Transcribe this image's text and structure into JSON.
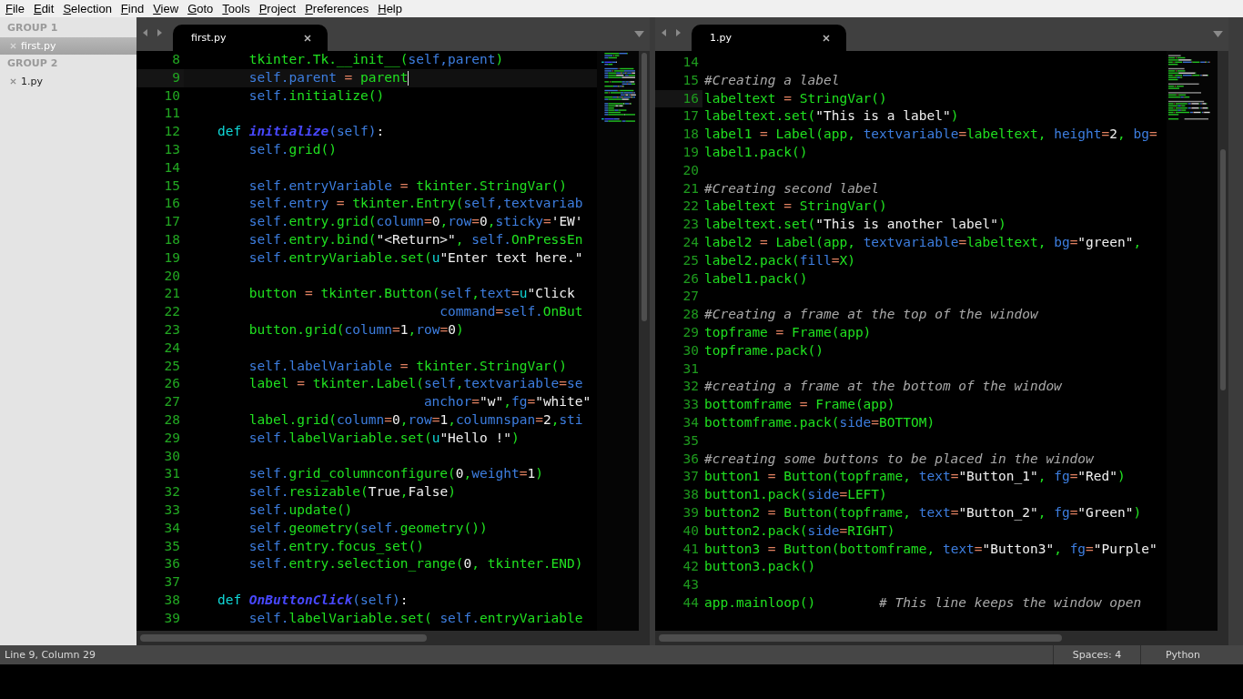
{
  "menu": [
    "File",
    "Edit",
    "Selection",
    "Find",
    "View",
    "Goto",
    "Tools",
    "Project",
    "Preferences",
    "Help"
  ],
  "sidebar": {
    "groups": [
      {
        "title": "GROUP 1",
        "files": [
          {
            "name": "first.py",
            "selected": true
          }
        ]
      },
      {
        "title": "GROUP 2",
        "files": [
          {
            "name": "1.py",
            "selected": false
          }
        ]
      }
    ]
  },
  "panes": [
    {
      "tabs": [
        {
          "label": "first.py",
          "selected": true
        }
      ],
      "focused": true,
      "lines": [
        {
          "num": "8",
          "current": false,
          "tokens": [
            {
              "kind": "name",
              "text": "        tkinter.Tk.__init__("
            },
            {
              "kind": "self",
              "text": "self,parent"
            },
            {
              "kind": "name",
              "text": ")"
            }
          ]
        },
        {
          "num": "9",
          "current": true,
          "tokens": [
            {
              "kind": "self",
              "text": "        self.parent"
            },
            {
              "kind": "op",
              "text": " = "
            },
            {
              "kind": "name",
              "text": "parent"
            }
          ]
        },
        {
          "num": "10",
          "current": false,
          "tokens": [
            {
              "kind": "self",
              "text": "        self."
            },
            {
              "kind": "name",
              "text": "initialize()"
            }
          ]
        },
        {
          "num": "11",
          "current": false
        },
        {
          "num": "12",
          "current": false,
          "tokens": [
            {
              "kind": "keyword",
              "text": "    def "
            },
            {
              "kind": "defname",
              "text": "initialize"
            },
            {
              "kind": "self",
              "text": "(self)"
            },
            {
              "kind": "literal",
              "text": ":"
            }
          ]
        },
        {
          "num": "13",
          "current": false,
          "tokens": [
            {
              "kind": "self",
              "text": "        self."
            },
            {
              "kind": "name",
              "text": "grid()"
            }
          ]
        },
        {
          "num": "14",
          "current": false
        },
        {
          "num": "15",
          "current": false,
          "tokens": [
            {
              "kind": "self",
              "text": "        self.entryVariable"
            },
            {
              "kind": "op",
              "text": " = "
            },
            {
              "kind": "name",
              "text": "tkinter.StringVar()"
            }
          ]
        },
        {
          "num": "16",
          "current": false,
          "tokens": [
            {
              "kind": "self",
              "text": "        self.entry"
            },
            {
              "kind": "op",
              "text": " = "
            },
            {
              "kind": "name",
              "text": "tkinter.Entry("
            },
            {
              "kind": "self",
              "text": "self,textvariab"
            }
          ]
        },
        {
          "num": "17",
          "current": false,
          "tokens": [
            {
              "kind": "self",
              "text": "        self."
            },
            {
              "kind": "name",
              "text": "entry.grid("
            },
            {
              "kind": "arg",
              "text": "column"
            },
            {
              "kind": "op",
              "text": "="
            },
            {
              "kind": "literal",
              "text": "0"
            },
            {
              "kind": "name",
              "text": ","
            },
            {
              "kind": "arg",
              "text": "row"
            },
            {
              "kind": "op",
              "text": "="
            },
            {
              "kind": "literal",
              "text": "0"
            },
            {
              "kind": "name",
              "text": ","
            },
            {
              "kind": "arg",
              "text": "sticky"
            },
            {
              "kind": "op",
              "text": "="
            },
            {
              "kind": "literal",
              "text": "'EW'"
            }
          ]
        },
        {
          "num": "18",
          "current": false,
          "tokens": [
            {
              "kind": "self",
              "text": "        self."
            },
            {
              "kind": "name",
              "text": "entry.bind("
            },
            {
              "kind": "literal",
              "text": "\"<Return>\""
            },
            {
              "kind": "name",
              "text": ", "
            },
            {
              "kind": "self",
              "text": "self."
            },
            {
              "kind": "name",
              "text": "OnPressEn"
            }
          ]
        },
        {
          "num": "19",
          "current": false,
          "tokens": [
            {
              "kind": "self",
              "text": "        self."
            },
            {
              "kind": "name",
              "text": "entryVariable.set("
            },
            {
              "kind": "keyword",
              "text": "u"
            },
            {
              "kind": "literal",
              "text": "\"Enter text here.\""
            }
          ]
        },
        {
          "num": "20",
          "current": false
        },
        {
          "num": "21",
          "current": false,
          "tokens": [
            {
              "kind": "name",
              "text": "        button"
            },
            {
              "kind": "op",
              "text": " = "
            },
            {
              "kind": "name",
              "text": "tkinter.Button("
            },
            {
              "kind": "self",
              "text": "self"
            },
            {
              "kind": "name",
              "text": ","
            },
            {
              "kind": "arg",
              "text": "text"
            },
            {
              "kind": "op",
              "text": "="
            },
            {
              "kind": "keyword",
              "text": "u"
            },
            {
              "kind": "literal",
              "text": "\"Click"
            }
          ]
        },
        {
          "num": "22",
          "current": false,
          "tokens": [
            {
              "kind": "arg",
              "text": "                                command"
            },
            {
              "kind": "op",
              "text": "="
            },
            {
              "kind": "self",
              "text": "self."
            },
            {
              "kind": "name",
              "text": "OnBut"
            }
          ]
        },
        {
          "num": "23",
          "current": false,
          "tokens": [
            {
              "kind": "name",
              "text": "        button.grid("
            },
            {
              "kind": "arg",
              "text": "column"
            },
            {
              "kind": "op",
              "text": "="
            },
            {
              "kind": "literal",
              "text": "1"
            },
            {
              "kind": "name",
              "text": ","
            },
            {
              "kind": "arg",
              "text": "row"
            },
            {
              "kind": "op",
              "text": "="
            },
            {
              "kind": "literal",
              "text": "0"
            },
            {
              "kind": "name",
              "text": ")"
            }
          ]
        },
        {
          "num": "24",
          "current": false
        },
        {
          "num": "25",
          "current": false,
          "tokens": [
            {
              "kind": "self",
              "text": "        self.labelVariable"
            },
            {
              "kind": "op",
              "text": " = "
            },
            {
              "kind": "name",
              "text": "tkinter.StringVar()"
            }
          ]
        },
        {
          "num": "26",
          "current": false,
          "tokens": [
            {
              "kind": "name",
              "text": "        label"
            },
            {
              "kind": "op",
              "text": " = "
            },
            {
              "kind": "name",
              "text": "tkinter.Label("
            },
            {
              "kind": "self",
              "text": "self"
            },
            {
              "kind": "name",
              "text": ","
            },
            {
              "kind": "arg",
              "text": "textvariable"
            },
            {
              "kind": "op",
              "text": "="
            },
            {
              "kind": "self",
              "text": "se"
            }
          ]
        },
        {
          "num": "27",
          "current": false,
          "tokens": [
            {
              "kind": "arg",
              "text": "                              anchor"
            },
            {
              "kind": "op",
              "text": "="
            },
            {
              "kind": "literal",
              "text": "\"w\""
            },
            {
              "kind": "name",
              "text": ","
            },
            {
              "kind": "arg",
              "text": "fg"
            },
            {
              "kind": "op",
              "text": "="
            },
            {
              "kind": "literal",
              "text": "\"white\""
            }
          ]
        },
        {
          "num": "28",
          "current": false,
          "tokens": [
            {
              "kind": "name",
              "text": "        label.grid("
            },
            {
              "kind": "arg",
              "text": "column"
            },
            {
              "kind": "op",
              "text": "="
            },
            {
              "kind": "literal",
              "text": "0"
            },
            {
              "kind": "name",
              "text": ","
            },
            {
              "kind": "arg",
              "text": "row"
            },
            {
              "kind": "op",
              "text": "="
            },
            {
              "kind": "literal",
              "text": "1"
            },
            {
              "kind": "name",
              "text": ","
            },
            {
              "kind": "arg",
              "text": "columnspan"
            },
            {
              "kind": "op",
              "text": "="
            },
            {
              "kind": "literal",
              "text": "2"
            },
            {
              "kind": "name",
              "text": ","
            },
            {
              "kind": "arg",
              "text": "sti"
            }
          ]
        },
        {
          "num": "29",
          "current": false,
          "tokens": [
            {
              "kind": "self",
              "text": "        self."
            },
            {
              "kind": "name",
              "text": "labelVariable.set("
            },
            {
              "kind": "keyword",
              "text": "u"
            },
            {
              "kind": "literal",
              "text": "\"Hello !\""
            },
            {
              "kind": "name",
              "text": ")"
            }
          ]
        },
        {
          "num": "30",
          "current": false
        },
        {
          "num": "31",
          "current": false,
          "tokens": [
            {
              "kind": "self",
              "text": "        self."
            },
            {
              "kind": "name",
              "text": "grid_columnconfigure("
            },
            {
              "kind": "literal",
              "text": "0"
            },
            {
              "kind": "name",
              "text": ","
            },
            {
              "kind": "arg",
              "text": "weight"
            },
            {
              "kind": "op",
              "text": "="
            },
            {
              "kind": "literal",
              "text": "1"
            },
            {
              "kind": "name",
              "text": ")"
            }
          ]
        },
        {
          "num": "32",
          "current": false,
          "tokens": [
            {
              "kind": "self",
              "text": "        self."
            },
            {
              "kind": "name",
              "text": "resizable("
            },
            {
              "kind": "literal",
              "text": "True"
            },
            {
              "kind": "name",
              "text": ","
            },
            {
              "kind": "literal",
              "text": "False"
            },
            {
              "kind": "name",
              "text": ")"
            }
          ]
        },
        {
          "num": "33",
          "current": false,
          "tokens": [
            {
              "kind": "self",
              "text": "        self."
            },
            {
              "kind": "name",
              "text": "update()"
            }
          ]
        },
        {
          "num": "34",
          "current": false,
          "tokens": [
            {
              "kind": "self",
              "text": "        self."
            },
            {
              "kind": "name",
              "text": "geometry("
            },
            {
              "kind": "self",
              "text": "self."
            },
            {
              "kind": "name",
              "text": "geometry())"
            }
          ]
        },
        {
          "num": "35",
          "current": false,
          "tokens": [
            {
              "kind": "self",
              "text": "        self."
            },
            {
              "kind": "name",
              "text": "entry.focus_set()"
            }
          ]
        },
        {
          "num": "36",
          "current": false,
          "tokens": [
            {
              "kind": "self",
              "text": "        self."
            },
            {
              "kind": "name",
              "text": "entry.selection_range("
            },
            {
              "kind": "literal",
              "text": "0"
            },
            {
              "kind": "name",
              "text": ", tkinter.END)"
            }
          ]
        },
        {
          "num": "37",
          "current": false
        },
        {
          "num": "38",
          "current": false,
          "tokens": [
            {
              "kind": "keyword",
              "text": "    def "
            },
            {
              "kind": "defname",
              "text": "OnButtonClick"
            },
            {
              "kind": "self",
              "text": "(self)"
            },
            {
              "kind": "literal",
              "text": ":"
            }
          ]
        },
        {
          "num": "39",
          "current": false,
          "tokens": [
            {
              "kind": "self",
              "text": "        self."
            },
            {
              "kind": "name",
              "text": "labelVariable.set( "
            },
            {
              "kind": "self",
              "text": "self."
            },
            {
              "kind": "name",
              "text": "entryVariable"
            }
          ]
        }
      ]
    },
    {
      "tabs": [
        {
          "label": "1.py",
          "selected": true
        }
      ],
      "focused": false,
      "lines": [
        {
          "num": "14",
          "current": false
        },
        {
          "num": "15",
          "current": false,
          "tokens": [
            {
              "kind": "comment",
              "text": "#Creating a label"
            }
          ]
        },
        {
          "num": "16",
          "current": true,
          "tokens": [
            {
              "kind": "name",
              "text": "labeltext"
            },
            {
              "kind": "op",
              "text": " = "
            },
            {
              "kind": "name",
              "text": "StringVar()"
            }
          ]
        },
        {
          "num": "17",
          "current": false,
          "tokens": [
            {
              "kind": "name",
              "text": "labeltext.set("
            },
            {
              "kind": "literal",
              "text": "\"This is a label\""
            },
            {
              "kind": "name",
              "text": ")"
            }
          ]
        },
        {
          "num": "18",
          "current": false,
          "tokens": [
            {
              "kind": "name",
              "text": "label1"
            },
            {
              "kind": "op",
              "text": " = "
            },
            {
              "kind": "name",
              "text": "Label(app, "
            },
            {
              "kind": "arg",
              "text": "textvariable"
            },
            {
              "kind": "op",
              "text": "="
            },
            {
              "kind": "name",
              "text": "labeltext, "
            },
            {
              "kind": "arg",
              "text": "height"
            },
            {
              "kind": "op",
              "text": "="
            },
            {
              "kind": "literal",
              "text": "2"
            },
            {
              "kind": "name",
              "text": ", "
            },
            {
              "kind": "arg",
              "text": "bg"
            },
            {
              "kind": "op",
              "text": "="
            }
          ]
        },
        {
          "num": "19",
          "current": false,
          "tokens": [
            {
              "kind": "name",
              "text": "label1.pack()"
            }
          ]
        },
        {
          "num": "20",
          "current": false
        },
        {
          "num": "21",
          "current": false,
          "tokens": [
            {
              "kind": "comment",
              "text": "#Creating second label"
            }
          ]
        },
        {
          "num": "22",
          "current": false,
          "tokens": [
            {
              "kind": "name",
              "text": "labeltext"
            },
            {
              "kind": "op",
              "text": " = "
            },
            {
              "kind": "name",
              "text": "StringVar()"
            }
          ]
        },
        {
          "num": "23",
          "current": false,
          "tokens": [
            {
              "kind": "name",
              "text": "labeltext.set("
            },
            {
              "kind": "literal",
              "text": "\"This is another label\""
            },
            {
              "kind": "name",
              "text": ")"
            }
          ]
        },
        {
          "num": "24",
          "current": false,
          "tokens": [
            {
              "kind": "name",
              "text": "label2"
            },
            {
              "kind": "op",
              "text": " = "
            },
            {
              "kind": "name",
              "text": "Label(app, "
            },
            {
              "kind": "arg",
              "text": "textvariable"
            },
            {
              "kind": "op",
              "text": "="
            },
            {
              "kind": "name",
              "text": "labeltext, "
            },
            {
              "kind": "arg",
              "text": "bg"
            },
            {
              "kind": "op",
              "text": "="
            },
            {
              "kind": "literal",
              "text": "\"green\""
            },
            {
              "kind": "name",
              "text": ","
            }
          ]
        },
        {
          "num": "25",
          "current": false,
          "tokens": [
            {
              "kind": "name",
              "text": "label2.pack("
            },
            {
              "kind": "arg",
              "text": "fill"
            },
            {
              "kind": "op",
              "text": "="
            },
            {
              "kind": "name",
              "text": "X)"
            }
          ]
        },
        {
          "num": "26",
          "current": false,
          "tokens": [
            {
              "kind": "name",
              "text": "label1.pack()"
            }
          ]
        },
        {
          "num": "27",
          "current": false
        },
        {
          "num": "28",
          "current": false,
          "tokens": [
            {
              "kind": "comment",
              "text": "#Creating a frame at the top of the window"
            }
          ]
        },
        {
          "num": "29",
          "current": false,
          "tokens": [
            {
              "kind": "name",
              "text": "topframe"
            },
            {
              "kind": "op",
              "text": " = "
            },
            {
              "kind": "name",
              "text": "Frame(app)"
            }
          ]
        },
        {
          "num": "30",
          "current": false,
          "tokens": [
            {
              "kind": "name",
              "text": "topframe.pack()"
            }
          ]
        },
        {
          "num": "31",
          "current": false
        },
        {
          "num": "32",
          "current": false,
          "tokens": [
            {
              "kind": "comment",
              "text": "#creating a frame at the bottom of the window"
            }
          ]
        },
        {
          "num": "33",
          "current": false,
          "tokens": [
            {
              "kind": "name",
              "text": "bottomframe"
            },
            {
              "kind": "op",
              "text": " = "
            },
            {
              "kind": "name",
              "text": "Frame(app)"
            }
          ]
        },
        {
          "num": "34",
          "current": false,
          "tokens": [
            {
              "kind": "name",
              "text": "bottomframe.pack("
            },
            {
              "kind": "arg",
              "text": "side"
            },
            {
              "kind": "op",
              "text": "="
            },
            {
              "kind": "name",
              "text": "BOTTOM)"
            }
          ]
        },
        {
          "num": "35",
          "current": false
        },
        {
          "num": "36",
          "current": false,
          "tokens": [
            {
              "kind": "comment",
              "text": "#creating some buttons to be placed in the window"
            }
          ]
        },
        {
          "num": "37",
          "current": false,
          "tokens": [
            {
              "kind": "name",
              "text": "button1"
            },
            {
              "kind": "op",
              "text": " = "
            },
            {
              "kind": "name",
              "text": "Button(topframe, "
            },
            {
              "kind": "arg",
              "text": "text"
            },
            {
              "kind": "op",
              "text": "="
            },
            {
              "kind": "literal",
              "text": "\"Button_1\""
            },
            {
              "kind": "name",
              "text": ", "
            },
            {
              "kind": "arg",
              "text": "fg"
            },
            {
              "kind": "op",
              "text": "="
            },
            {
              "kind": "literal",
              "text": "\"Red\""
            },
            {
              "kind": "name",
              "text": ")"
            }
          ]
        },
        {
          "num": "38",
          "current": false,
          "tokens": [
            {
              "kind": "name",
              "text": "button1.pack("
            },
            {
              "kind": "arg",
              "text": "side"
            },
            {
              "kind": "op",
              "text": "="
            },
            {
              "kind": "name",
              "text": "LEFT)"
            }
          ]
        },
        {
          "num": "39",
          "current": false,
          "tokens": [
            {
              "kind": "name",
              "text": "button2"
            },
            {
              "kind": "op",
              "text": " = "
            },
            {
              "kind": "name",
              "text": "Button(topframe, "
            },
            {
              "kind": "arg",
              "text": "text"
            },
            {
              "kind": "op",
              "text": "="
            },
            {
              "kind": "literal",
              "text": "\"Button_2\""
            },
            {
              "kind": "name",
              "text": ", "
            },
            {
              "kind": "arg",
              "text": "fg"
            },
            {
              "kind": "op",
              "text": "="
            },
            {
              "kind": "literal",
              "text": "\"Green\""
            },
            {
              "kind": "name",
              "text": ")"
            }
          ]
        },
        {
          "num": "40",
          "current": false,
          "tokens": [
            {
              "kind": "name",
              "text": "button2.pack("
            },
            {
              "kind": "arg",
              "text": "side"
            },
            {
              "kind": "op",
              "text": "="
            },
            {
              "kind": "name",
              "text": "RIGHT)"
            }
          ]
        },
        {
          "num": "41",
          "current": false,
          "tokens": [
            {
              "kind": "name",
              "text": "button3"
            },
            {
              "kind": "op",
              "text": " = "
            },
            {
              "kind": "name",
              "text": "Button(bottomframe, "
            },
            {
              "kind": "arg",
              "text": "text"
            },
            {
              "kind": "op",
              "text": "="
            },
            {
              "kind": "literal",
              "text": "\"Button3\""
            },
            {
              "kind": "name",
              "text": ", "
            },
            {
              "kind": "arg",
              "text": "fg"
            },
            {
              "kind": "op",
              "text": "="
            },
            {
              "kind": "literal",
              "text": "\"Purple\""
            }
          ]
        },
        {
          "num": "42",
          "current": false,
          "tokens": [
            {
              "kind": "name",
              "text": "button3.pack()"
            }
          ]
        },
        {
          "num": "43",
          "current": false
        },
        {
          "num": "44",
          "current": false,
          "tokens": [
            {
              "kind": "name",
              "text": "app.mainloop()"
            },
            {
              "kind": "comment",
              "text": "        # This line keeps the window open"
            }
          ]
        }
      ]
    }
  ],
  "status_bar": {
    "position": "Line 9, Column 29",
    "indentation": "Spaces: 4",
    "syntax": "Python"
  }
}
